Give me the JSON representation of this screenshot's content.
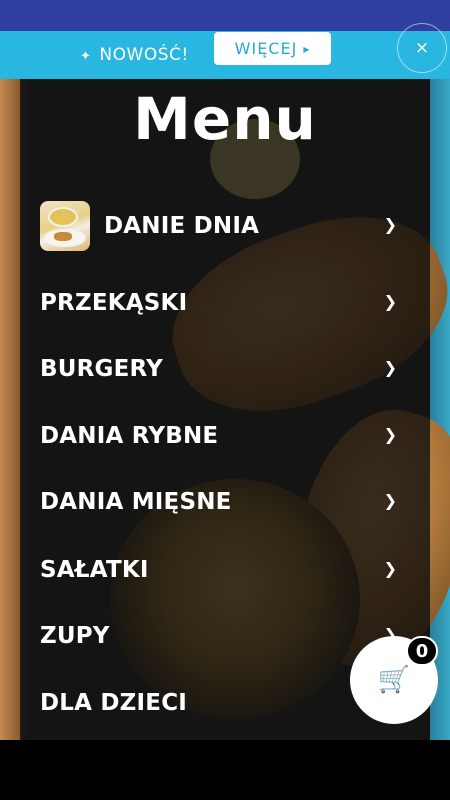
{
  "promo": {
    "icon": "sparkle-icon",
    "text": "NOWOŚĆ!",
    "more_label": "WIĘCEJ",
    "more_icon": "chevron-right-icon",
    "close_label": "×"
  },
  "menu": {
    "title": "Menu",
    "items": [
      {
        "label": "DANIE DNIA",
        "has_thumb": true
      },
      {
        "label": "PRZEKĄSKI"
      },
      {
        "label": "BURGERY"
      },
      {
        "label": "DANIA RYBNE"
      },
      {
        "label": "DANIA MIĘSNE"
      },
      {
        "label": "SAŁATKI"
      },
      {
        "label": "ZUPY"
      },
      {
        "label": "DLA DZIECI"
      }
    ]
  },
  "cart": {
    "icon": "cart-icon",
    "count": "0"
  },
  "colors": {
    "status_bar": "#303f9f",
    "promo_bar": "#29b6e0",
    "button_text": "#29a9d8"
  }
}
